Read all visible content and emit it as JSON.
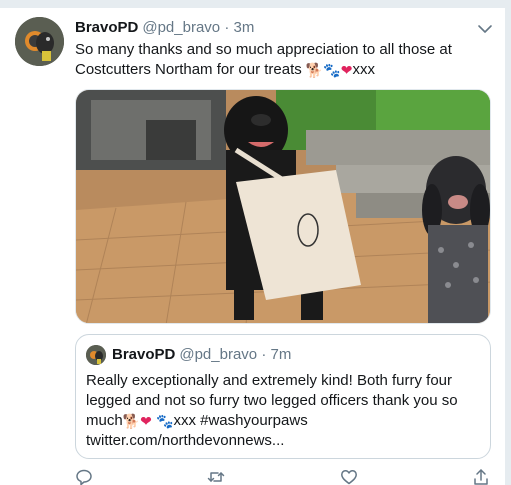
{
  "tweet": {
    "name": "BravoPD",
    "handle": "@pd_bravo",
    "dot": "·",
    "time": "3m",
    "text": "So many thanks and so much appreciation to all those at Costcutters Northam for our treats",
    "emojis": [
      "dog-emoji",
      "paw-prints-emoji",
      "red-heart-emoji"
    ],
    "emoji_glyphs": {
      "dog": "🐕",
      "paws": "🐾",
      "heart": "❤"
    },
    "text_suffix": "xxx"
  },
  "quoted_tweet": {
    "name": "BravoPD",
    "handle": "@pd_bravo",
    "dot": "·",
    "time": "7m",
    "text_main": "Really exceptionally and extremely kind! Both furry four legged and not so furry two legged officers thank you so much",
    "text_after_emoji": "xxx #washyourpaws",
    "link": "twitter.com/northdevonnews..."
  },
  "actions": [
    "reply-icon",
    "retweet-icon",
    "like-icon",
    "share-icon"
  ],
  "colors": {
    "text": "#14171a",
    "secondary": "#657786",
    "border": "#ccd6dd",
    "heart": "#e0245e"
  }
}
